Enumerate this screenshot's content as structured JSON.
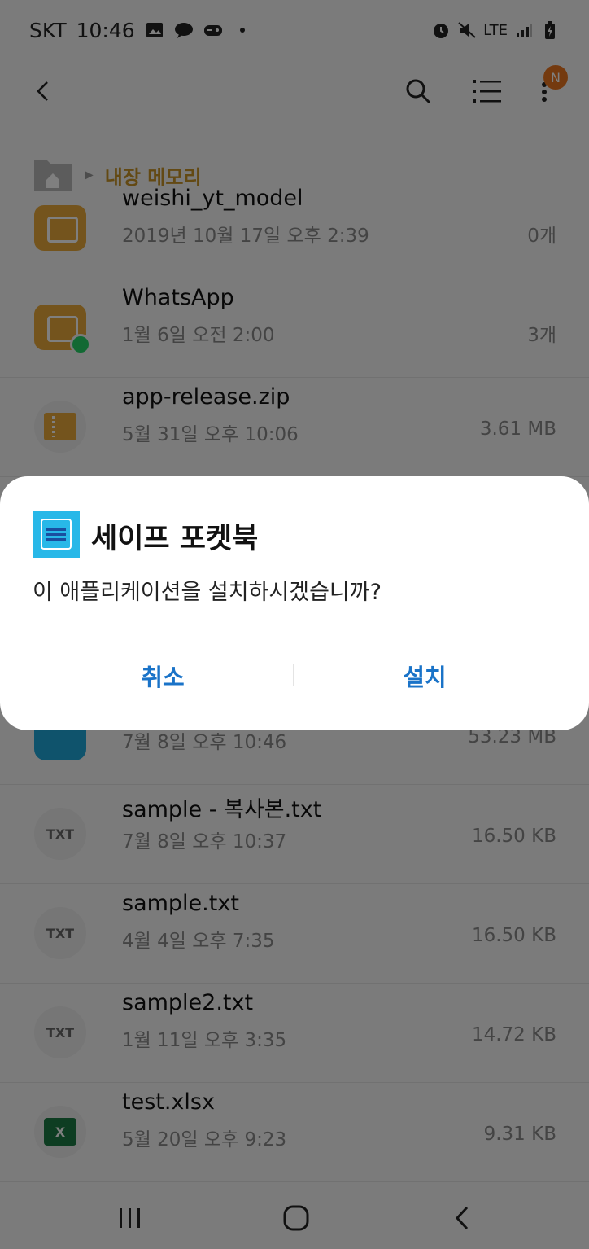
{
  "status_bar": {
    "carrier": "SKT",
    "time": "10:46",
    "network": "LTE"
  },
  "toolbar": {
    "badge": "N"
  },
  "breadcrumb": {
    "label": "내장 메모리"
  },
  "files": [
    {
      "name": "weishi_yt_model",
      "date": "2019년 10월 17일 오후 2:39",
      "size": "0개",
      "icon": "folder-icon"
    },
    {
      "name": "WhatsApp",
      "date": "1월 6일 오전 2:00",
      "size": "3개",
      "icon": "folder-whatsapp-icon"
    },
    {
      "name": "app-release.zip",
      "date": "5월 31일 오후 10:06",
      "size": "3.61 MB",
      "icon": "zip-icon"
    },
    {
      "name": "",
      "date": "",
      "size": "",
      "icon": "apk-icon"
    },
    {
      "name": "",
      "date": "7월 8일 오후 10:46",
      "size": "53.23 MB",
      "icon": "apk-icon"
    },
    {
      "name": "sample - 복사본.txt",
      "date": "7월 8일 오후 10:37",
      "size": "16.50 KB",
      "icon": "txt-icon"
    },
    {
      "name": "sample.txt",
      "date": "4월 4일 오후 7:35",
      "size": "16.50 KB",
      "icon": "txt-icon"
    },
    {
      "name": "sample2.txt",
      "date": "1월 11일 오후 3:35",
      "size": "14.72 KB",
      "icon": "txt-icon"
    },
    {
      "name": "test.xlsx",
      "date": "5월 20일 오후 9:23",
      "size": "9.31 KB",
      "icon": "xlsx-icon"
    }
  ],
  "icon_labels": {
    "txt": "TXT",
    "xls": "X"
  },
  "dialog": {
    "title": "세이프 포켓북",
    "message": "이 애플리케이션을 설치하시겠습니까?",
    "cancel_label": "취소",
    "install_label": "설치"
  },
  "colors": {
    "accent": "#1a73c8",
    "folder": "#e8a83a",
    "breadcrumb": "#c79326",
    "badge": "#e8741e"
  }
}
